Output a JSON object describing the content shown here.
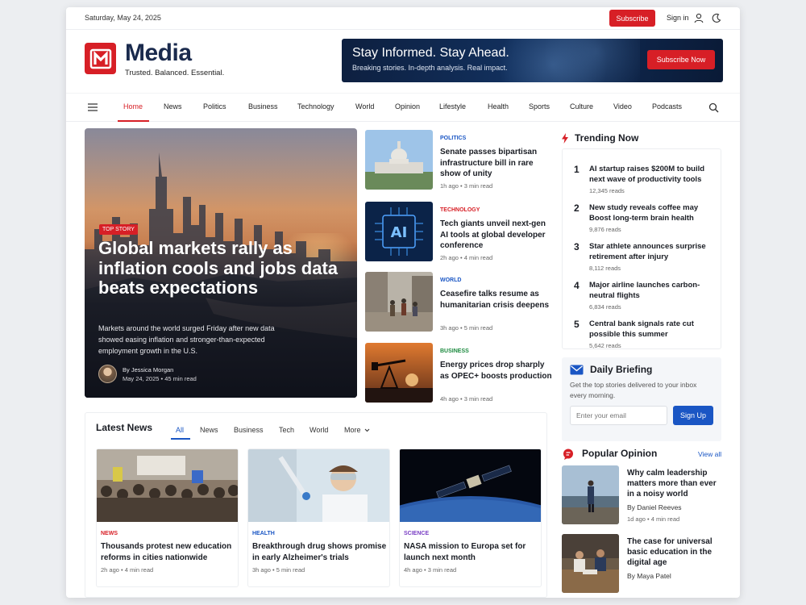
{
  "topbar": {
    "date": "Saturday, May 24, 2025",
    "subscribe_label": "Subscribe",
    "signin_label": "Sign in"
  },
  "brand": {
    "logo_letter": "M",
    "name": "Media",
    "tagline": "Trusted. Balanced. Essential.",
    "color": "#d71f26",
    "name_color": "#1a2a4d"
  },
  "banner": {
    "title": "Stay Informed. Stay Ahead.",
    "subtitle": "Breaking stories. In-depth analysis. Real impact.",
    "button_label": "Subscribe Now"
  },
  "nav": {
    "items": [
      "Home",
      "News",
      "Politics",
      "Business",
      "Technology",
      "World",
      "Opinion",
      "Lifestyle",
      "Health",
      "Sports",
      "Culture",
      "Video",
      "Podcasts"
    ],
    "active": "Home",
    "menu_icon": "hamburger-icon",
    "search_icon": "search-icon"
  },
  "hero": {
    "tag": "TOP STORY",
    "title": "Global markets rally as inflation cools and jobs data beats expectations",
    "description": "Markets around the world surged Friday after new data showed easing inflation and stronger-than-expected employment growth in the U.S.",
    "author": "By Jessica Morgan",
    "date": "May 24, 2025",
    "read_time": "45 min read"
  },
  "stories": [
    {
      "category": "POLITICS",
      "category_color": "#1a56c4",
      "headline": "Senate passes bipartisan infrastructure bill in rare show of unity",
      "time": "1h ago",
      "read": "3 min read"
    },
    {
      "category": "TECHNOLOGY",
      "category_color": "#d71f26",
      "headline": "Tech giants unveil next-gen AI tools at global developer conference",
      "time": "2h ago",
      "read": "4 min read"
    },
    {
      "category": "WORLD",
      "category_color": "#1a56c4",
      "headline": "Ceasefire talks resume as humanitarian crisis deepens",
      "time": "3h ago",
      "read": "5 min read"
    },
    {
      "category": "BUSINESS",
      "category_color": "#1c8a3f",
      "headline": "Energy prices drop sharply as OPEC+ boosts production",
      "time": "4h ago",
      "read": "3 min read"
    }
  ],
  "trending": {
    "heading": "Trending Now",
    "items": [
      {
        "rank": "1",
        "title": "AI startup raises $200M to build next wave of productivity tools",
        "reads": "12,345 reads"
      },
      {
        "rank": "2",
        "title": "New study reveals coffee may Boost long-term brain health",
        "reads": "9,876 reads"
      },
      {
        "rank": "3",
        "title": "Star athlete announces surprise retirement after injury",
        "reads": "8,112 reads"
      },
      {
        "rank": "4",
        "title": "Major airline launches carbon-neutral flights",
        "reads": "6,834 reads"
      },
      {
        "rank": "5",
        "title": "Central bank signals rate cut possible this summer",
        "reads": "5,642 reads"
      }
    ]
  },
  "briefing": {
    "heading": "Daily Briefing",
    "description": "Get the top stories delivered to your inbox every morning.",
    "email_placeholder": "Enter your email",
    "button_label": "Sign Up"
  },
  "opinion": {
    "heading": "Popular Opinion",
    "view_all": "View all",
    "items": [
      {
        "title": "Why calm leadership matters more than ever in a noisy world",
        "author": "By Daniel Reeves",
        "time": "1d ago",
        "read": "4 min read"
      },
      {
        "title": "The case for universal basic education in the digital age",
        "author": "By Maya Patel"
      }
    ]
  },
  "latest": {
    "heading": "Latest News",
    "tabs": [
      "All",
      "News",
      "Business",
      "Tech",
      "World",
      "More"
    ],
    "active_tab": "All",
    "cards": [
      {
        "category": "NEWS",
        "category_color": "#d71f26",
        "title": "Thousands protest new education reforms in cities nationwide",
        "time": "2h ago",
        "read": "4 min read"
      },
      {
        "category": "HEALTH",
        "category_color": "#1a56c4",
        "title": "Breakthrough drug shows promise in early Alzheimer's trials",
        "time": "3h ago",
        "read": "5 min read"
      },
      {
        "category": "SCIENCE",
        "category_color": "#7a3fc4",
        "title": "NASA mission to Europa set for launch next month",
        "time": "4h ago",
        "read": "3 min read"
      }
    ]
  }
}
